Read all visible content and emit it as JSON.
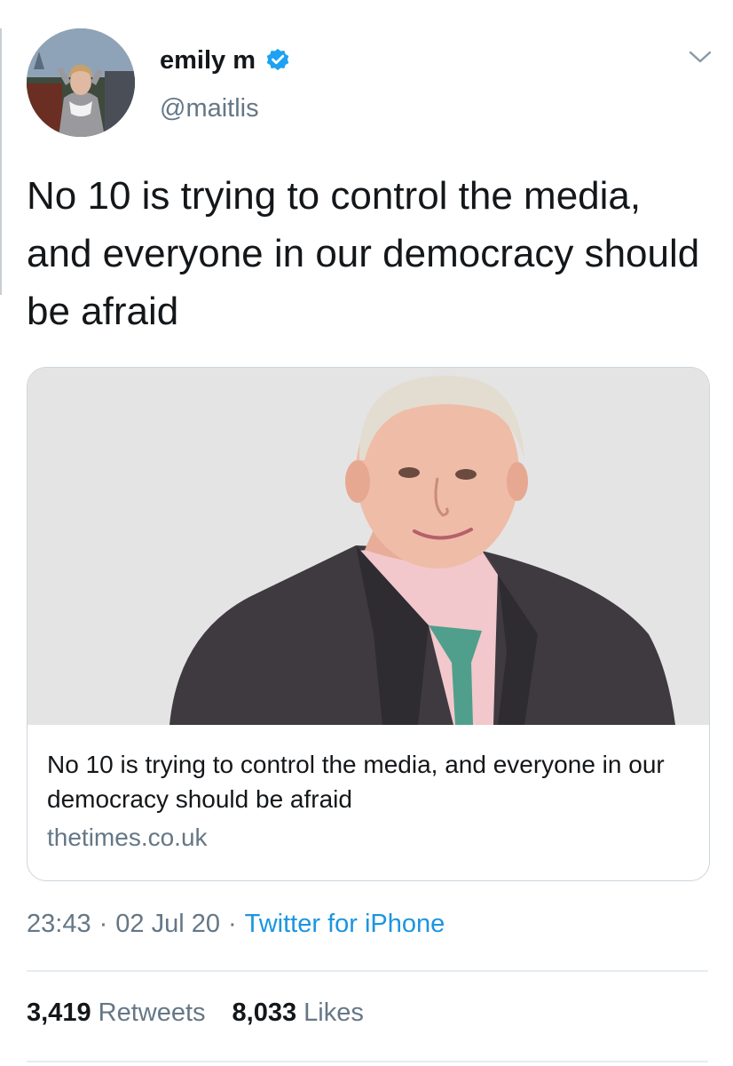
{
  "user": {
    "display_name": "emily m",
    "handle": "@maitlis",
    "verified": true
  },
  "tweet": {
    "text": "No 10 is trying to control the media, and everyone in our democracy should be afraid",
    "time": "23:43",
    "date": "02 Jul 20",
    "source": "Twitter for iPhone",
    "separator": "·"
  },
  "card": {
    "title": "No 10 is trying to control the media, and everyone in our democracy should be afraid",
    "domain": "thetimes.co.uk"
  },
  "stats": {
    "retweets_count": "3,419",
    "retweets_label": "Retweets",
    "likes_count": "8,033",
    "likes_label": "Likes"
  },
  "colors": {
    "text_primary": "#14171a",
    "text_secondary": "#657786",
    "link_blue": "#1b95e0",
    "verified_blue": "#1da1f2",
    "border": "#ccd6dd",
    "card_image_background": "#e4e4e4"
  },
  "icons": {
    "verified": "verified-badge-icon",
    "menu": "chevron-down-icon"
  }
}
